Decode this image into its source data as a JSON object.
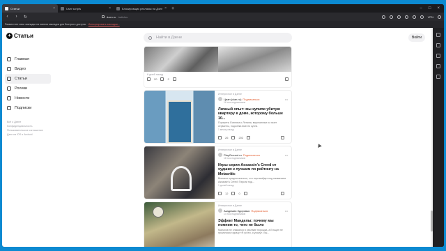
{
  "browser": {
    "tabs": [
      {
        "label": "Статьи",
        "active": true
      },
      {
        "label": "User scripts",
        "active": false
      },
      {
        "label": "Блокировщик рекламы на Дзен",
        "active": false
      }
    ],
    "url_host": "dzen.ru",
    "url_path": "/articles",
    "vpn_label": "VPN",
    "bookmark_hint": "Разместите свои закладки на панели закладок для быстрого доступа.",
    "bookmark_link": "Импортировать закладки..."
  },
  "header": {
    "logo_text": "Статьи",
    "search_placeholder": "Найти в Дзене",
    "login_label": "Войти"
  },
  "nav": {
    "items": [
      {
        "label": "Главная",
        "icon": "home-icon"
      },
      {
        "label": "Видео",
        "icon": "video-icon"
      },
      {
        "label": "Статьи",
        "icon": "articles-icon"
      },
      {
        "label": "Ролики",
        "icon": "clips-icon"
      },
      {
        "label": "Новости",
        "icon": "news-icon"
      },
      {
        "label": "Подписки",
        "icon": "subscriptions-icon"
      }
    ],
    "footer_links": [
      "Всё о Дзене",
      "Конфиденциальность",
      "Пользовательское соглашение",
      "Дзен на iOS и Android"
    ]
  },
  "feed": {
    "top_card": {
      "age": "6 дней назад",
      "likes": "20",
      "comments": "2"
    },
    "cards": [
      {
        "category": "Интересное в Дзене",
        "channel": "Циан (cian.ru)",
        "subscribe": "Подписаться",
        "subscribers": "16 тыс подписчиков",
        "title": "Личный опыт: мы купили убитую квартиру в доме, которому больше 10...",
        "description": "Портреты Есенина и Ленина, вырезанные из газет серванты, подсобка вместо кухни.",
        "age": "1 месяц назад",
        "likes": "26",
        "comments": "202"
      },
      {
        "category": "Интересное в Дзене",
        "channel": "PlayGround.ru",
        "subscribe": "Подписаться",
        "subscribers": "18 тыс подписчиков",
        "title": "Игры серии Assassin's Creed от худших к лучшим по рейтингу на Metacritic",
        "description": "Вначале предполагалось, что игра выйдет под названием Assassin's Creed: Пэрсии под...",
        "age": "1 долей назад",
        "likes": "12",
        "comments": "0"
      },
      {
        "category": "Интересное в Дзене",
        "channel": "Академия Здоровья",
        "subscribe": "Подписаться",
        "subscribers": "14 тыс подписчиков",
        "title": "Эффект Манделы: почему мы помним то, чего не было",
        "description": "Малахов не снимался в рекламе порошка, а Ельцин не произносил фразу «Я устал, я ухожу». Вы...",
        "age": "",
        "likes": "",
        "comments": ""
      }
    ]
  }
}
